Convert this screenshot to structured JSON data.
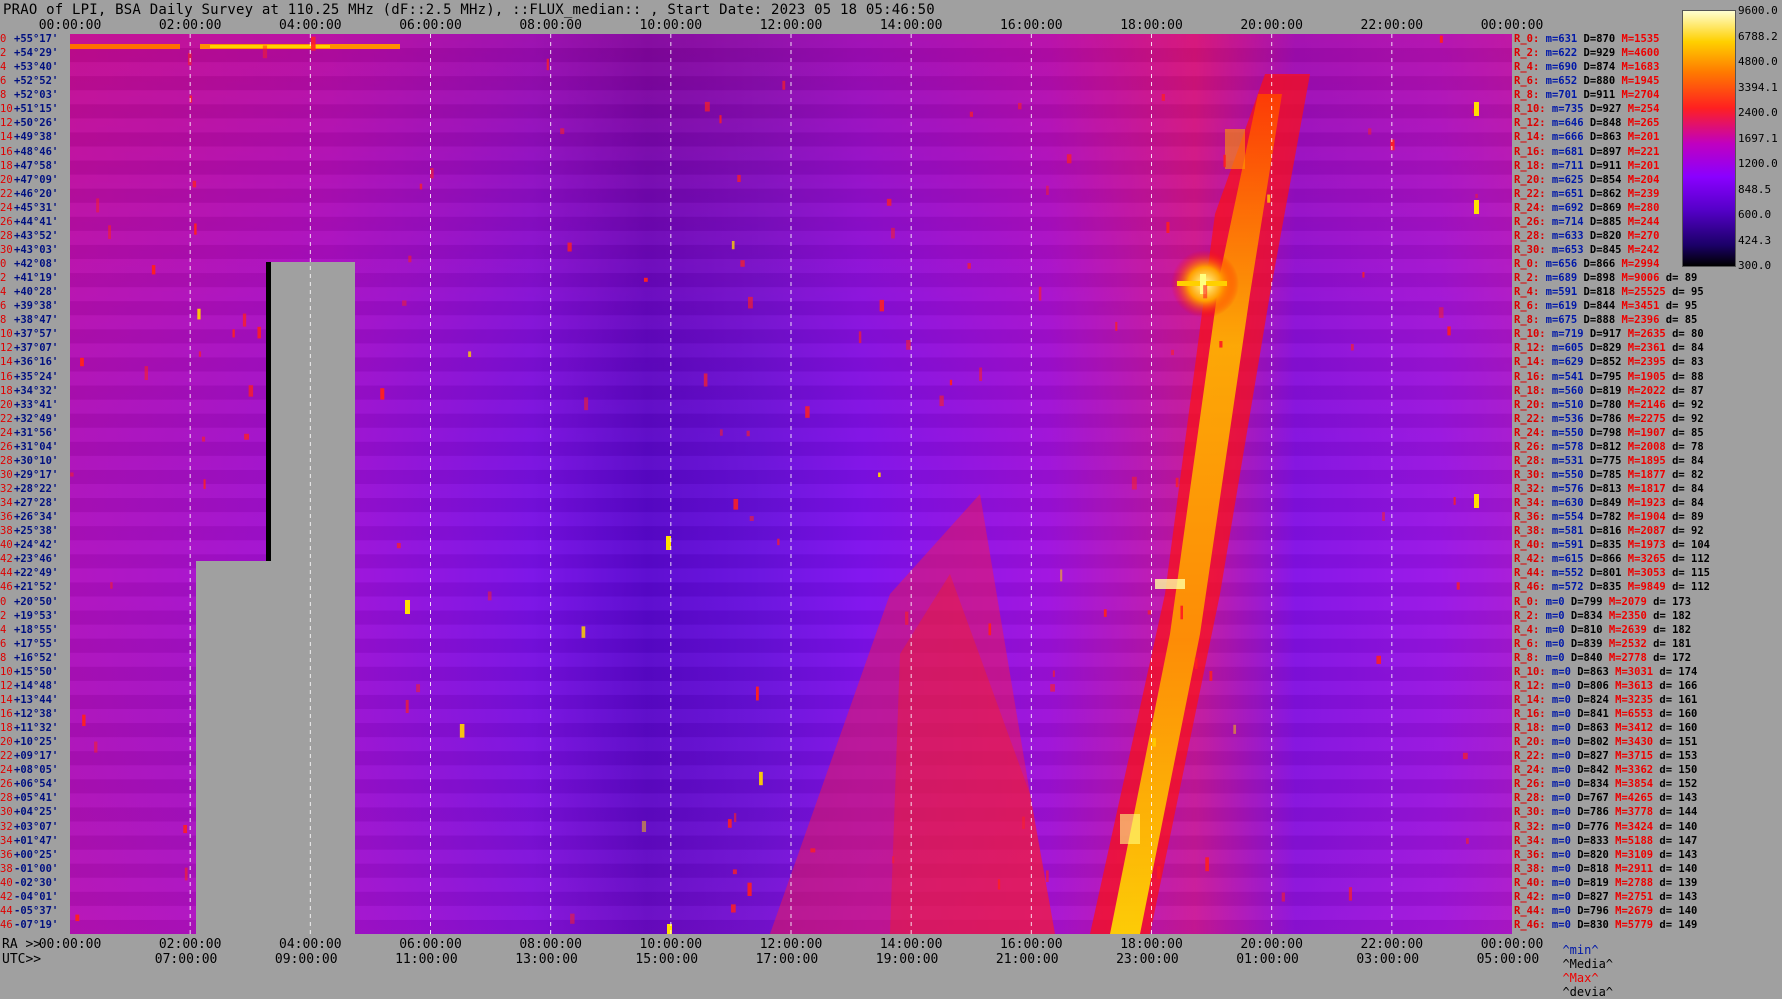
{
  "title": "PRAO of LPI, BSA Daily Survey at 110.25 MHz (dF::2.5 MHz), ::FLUX_median:: , Start Date: 2023 05 18 05:46:50",
  "top_axis": [
    "00:00:00",
    "02:00:00",
    "04:00:00",
    "06:00:00",
    "08:00:00",
    "10:00:00",
    "12:00:00",
    "14:00:00",
    "16:00:00",
    "18:00:00",
    "20:00:00",
    "22:00:00",
    "00:00:00"
  ],
  "bottom_axis_ra": {
    "prefix": "RA >>",
    "ticks": [
      "00:00:00",
      "02:00:00",
      "04:00:00",
      "06:00:00",
      "08:00:00",
      "10:00:00",
      "12:00:00",
      "14:00:00",
      "16:00:00",
      "18:00:00",
      "20:00:00",
      "22:00:00",
      "00:00:00"
    ]
  },
  "bottom_axis_utc": {
    "prefix": "UTC>>",
    "ticks": [
      "07:00:00",
      "09:00:00",
      "11:00:00",
      "13:00:00",
      "15:00:00",
      "17:00:00",
      "19:00:00",
      "21:00:00",
      "23:00:00",
      "01:00:00",
      "03:00:00",
      "05:00:00"
    ]
  },
  "dec_rows": [
    {
      "i": "0",
      "d": "+55°17'"
    },
    {
      "i": "2",
      "d": "+54°29'"
    },
    {
      "i": "4",
      "d": "+53°40'"
    },
    {
      "i": "6",
      "d": "+52°52'"
    },
    {
      "i": "8",
      "d": "+52°03'"
    },
    {
      "i": "10",
      "d": "+51°15'"
    },
    {
      "i": "12",
      "d": "+50°26'"
    },
    {
      "i": "14",
      "d": "+49°38'"
    },
    {
      "i": "16",
      "d": "+48°46'"
    },
    {
      "i": "18",
      "d": "+47°58'"
    },
    {
      "i": "20",
      "d": "+47°09'"
    },
    {
      "i": "22",
      "d": "+46°20'"
    },
    {
      "i": "24",
      "d": "+45°31'"
    },
    {
      "i": "26",
      "d": "+44°41'"
    },
    {
      "i": "28",
      "d": "+43°52'"
    },
    {
      "i": "30",
      "d": "+43°03'"
    },
    {
      "i": "0",
      "d": "+42°08'"
    },
    {
      "i": "2",
      "d": "+41°19'"
    },
    {
      "i": "4",
      "d": "+40°28'"
    },
    {
      "i": "6",
      "d": "+39°38'"
    },
    {
      "i": "8",
      "d": "+38°47'"
    },
    {
      "i": "10",
      "d": "+37°57'"
    },
    {
      "i": "12",
      "d": "+37°07'"
    },
    {
      "i": "14",
      "d": "+36°16'"
    },
    {
      "i": "16",
      "d": "+35°24'"
    },
    {
      "i": "18",
      "d": "+34°32'"
    },
    {
      "i": "20",
      "d": "+33°41'"
    },
    {
      "i": "22",
      "d": "+32°49'"
    },
    {
      "i": "24",
      "d": "+31°56'"
    },
    {
      "i": "26",
      "d": "+31°04'"
    },
    {
      "i": "28",
      "d": "+30°10'"
    },
    {
      "i": "30",
      "d": "+29°17'"
    },
    {
      "i": "32",
      "d": "+28°22'"
    },
    {
      "i": "34",
      "d": "+27°28'"
    },
    {
      "i": "36",
      "d": "+26°34'"
    },
    {
      "i": "38",
      "d": "+25°38'"
    },
    {
      "i": "40",
      "d": "+24°42'"
    },
    {
      "i": "42",
      "d": "+23°46'"
    },
    {
      "i": "44",
      "d": "+22°49'"
    },
    {
      "i": "46",
      "d": "+21°52'"
    },
    {
      "i": "0",
      "d": "+20°50'"
    },
    {
      "i": "2",
      "d": "+19°53'"
    },
    {
      "i": "4",
      "d": "+18°55'"
    },
    {
      "i": "6",
      "d": "+17°55'"
    },
    {
      "i": "8",
      "d": "+16°52'"
    },
    {
      "i": "10",
      "d": "+15°50'"
    },
    {
      "i": "12",
      "d": "+14°48'"
    },
    {
      "i": "14",
      "d": "+13°44'"
    },
    {
      "i": "16",
      "d": "+12°38'"
    },
    {
      "i": "18",
      "d": "+11°32'"
    },
    {
      "i": "20",
      "d": "+10°25'"
    },
    {
      "i": "22",
      "d": "+09°17'"
    },
    {
      "i": "24",
      "d": "+08°05'"
    },
    {
      "i": "26",
      "d": "+06°54'"
    },
    {
      "i": "28",
      "d": "+05°41'"
    },
    {
      "i": "30",
      "d": "+04°25'"
    },
    {
      "i": "32",
      "d": "+03°07'"
    },
    {
      "i": "34",
      "d": "+01°47'"
    },
    {
      "i": "36",
      "d": "+00°25'"
    },
    {
      "i": "38",
      "d": "-01°00'"
    },
    {
      "i": "40",
      "d": "-02°30'"
    },
    {
      "i": "42",
      "d": "-04°01'"
    },
    {
      "i": "44",
      "d": "-05°37'"
    },
    {
      "i": "46",
      "d": "-07°19'"
    }
  ],
  "colorbar": {
    "ticks": [
      "9600.0",
      "6788.2",
      "4800.0",
      "3394.1",
      "2400.0",
      "1697.1",
      "1200.0",
      "848.5",
      "600.0",
      "424.3",
      "300.0"
    ],
    "colors": [
      "#000000",
      "#1a0066",
      "#5500c8",
      "#8a00ff",
      "#c000c0",
      "#ff2020",
      "#ff7a00",
      "#ffd000",
      "#ffffd0"
    ]
  },
  "stats": [
    {
      "r": "R_0:",
      "m": "m=631",
      "D": "D=870",
      "M": "M=1535",
      "d": ""
    },
    {
      "r": "R_2:",
      "m": "m=622",
      "D": "D=929",
      "M": "M=4600",
      "d": ""
    },
    {
      "r": "R_4:",
      "m": "m=690",
      "D": "D=874",
      "M": "M=1683",
      "d": ""
    },
    {
      "r": "R_6:",
      "m": "m=652",
      "D": "D=880",
      "M": "M=1945",
      "d": ""
    },
    {
      "r": "R_8:",
      "m": "m=701",
      "D": "D=911",
      "M": "M=2704",
      "d": ""
    },
    {
      "r": "R_10:",
      "m": "m=735",
      "D": "D=927",
      "M": "M=254",
      "d": ""
    },
    {
      "r": "R_12:",
      "m": "m=646",
      "D": "D=848",
      "M": "M=265",
      "d": ""
    },
    {
      "r": "R_14:",
      "m": "m=666",
      "D": "D=863",
      "M": "M=201",
      "d": ""
    },
    {
      "r": "R_16:",
      "m": "m=681",
      "D": "D=897",
      "M": "M=221",
      "d": ""
    },
    {
      "r": "R_18:",
      "m": "m=711",
      "D": "D=911",
      "M": "M=201",
      "d": ""
    },
    {
      "r": "R_20:",
      "m": "m=625",
      "D": "D=854",
      "M": "M=204",
      "d": ""
    },
    {
      "r": "R_22:",
      "m": "m=651",
      "D": "D=862",
      "M": "M=239",
      "d": ""
    },
    {
      "r": "R_24:",
      "m": "m=692",
      "D": "D=869",
      "M": "M=280",
      "d": ""
    },
    {
      "r": "R_26:",
      "m": "m=714",
      "D": "D=885",
      "M": "M=244",
      "d": ""
    },
    {
      "r": "R_28:",
      "m": "m=633",
      "D": "D=820",
      "M": "M=270",
      "d": ""
    },
    {
      "r": "R_30:",
      "m": "m=653",
      "D": "D=845",
      "M": "M=242",
      "d": ""
    },
    {
      "r": "R_0:",
      "m": "m=656",
      "D": "D=866",
      "M": "M=2994",
      "d": ""
    },
    {
      "r": "R_2:",
      "m": "m=689",
      "D": "D=898",
      "M": "M=9006",
      "d": "d= 89"
    },
    {
      "r": "R_4:",
      "m": "m=591",
      "D": "D=818",
      "M": "M=25525",
      "d": "d= 95"
    },
    {
      "r": "R_6:",
      "m": "m=619",
      "D": "D=844",
      "M": "M=3451",
      "d": "d= 95"
    },
    {
      "r": "R_8:",
      "m": "m=675",
      "D": "D=888",
      "M": "M=2396",
      "d": "d= 85"
    },
    {
      "r": "R_10:",
      "m": "m=719",
      "D": "D=917",
      "M": "M=2635",
      "d": "d= 80"
    },
    {
      "r": "R_12:",
      "m": "m=605",
      "D": "D=829",
      "M": "M=2361",
      "d": "d= 84"
    },
    {
      "r": "R_14:",
      "m": "m=629",
      "D": "D=852",
      "M": "M=2395",
      "d": "d= 83"
    },
    {
      "r": "R_16:",
      "m": "m=541",
      "D": "D=795",
      "M": "M=1905",
      "d": "d= 88"
    },
    {
      "r": "R_18:",
      "m": "m=560",
      "D": "D=819",
      "M": "M=2022",
      "d": "d= 87"
    },
    {
      "r": "R_20:",
      "m": "m=510",
      "D": "D=780",
      "M": "M=2146",
      "d": "d= 92"
    },
    {
      "r": "R_22:",
      "m": "m=536",
      "D": "D=786",
      "M": "M=2275",
      "d": "d= 92"
    },
    {
      "r": "R_24:",
      "m": "m=550",
      "D": "D=798",
      "M": "M=1907",
      "d": "d= 85"
    },
    {
      "r": "R_26:",
      "m": "m=578",
      "D": "D=812",
      "M": "M=2008",
      "d": "d= 78"
    },
    {
      "r": "R_28:",
      "m": "m=531",
      "D": "D=775",
      "M": "M=1895",
      "d": "d= 84"
    },
    {
      "r": "R_30:",
      "m": "m=550",
      "D": "D=785",
      "M": "M=1877",
      "d": "d= 82"
    },
    {
      "r": "R_32:",
      "m": "m=576",
      "D": "D=813",
      "M": "M=1817",
      "d": "d= 84"
    },
    {
      "r": "R_34:",
      "m": "m=630",
      "D": "D=849",
      "M": "M=1923",
      "d": "d= 84"
    },
    {
      "r": "R_36:",
      "m": "m=554",
      "D": "D=782",
      "M": "M=1904",
      "d": "d= 89"
    },
    {
      "r": "R_38:",
      "m": "m=581",
      "D": "D=816",
      "M": "M=2087",
      "d": "d= 92"
    },
    {
      "r": "R_40:",
      "m": "m=591",
      "D": "D=835",
      "M": "M=1973",
      "d": "d= 104"
    },
    {
      "r": "R_42:",
      "m": "m=615",
      "D": "D=866",
      "M": "M=3265",
      "d": "d= 112"
    },
    {
      "r": "R_44:",
      "m": "m=552",
      "D": "D=801",
      "M": "M=3053",
      "d": "d= 115"
    },
    {
      "r": "R_46:",
      "m": "m=572",
      "D": "D=835",
      "M": "M=9849",
      "d": "d= 112"
    },
    {
      "r": "R_0:",
      "m": "m=0",
      "D": "D=799",
      "M": "M=2079",
      "d": "d= 173"
    },
    {
      "r": "R_2:",
      "m": "m=0",
      "D": "D=834",
      "M": "M=2350",
      "d": "d= 182"
    },
    {
      "r": "R_4:",
      "m": "m=0",
      "D": "D=810",
      "M": "M=2639",
      "d": "d= 182"
    },
    {
      "r": "R_6:",
      "m": "m=0",
      "D": "D=839",
      "M": "M=2532",
      "d": "d= 181"
    },
    {
      "r": "R_8:",
      "m": "m=0",
      "D": "D=840",
      "M": "M=2778",
      "d": "d= 172"
    },
    {
      "r": "R_10:",
      "m": "m=0",
      "D": "D=863",
      "M": "M=3031",
      "d": "d= 174"
    },
    {
      "r": "R_12:",
      "m": "m=0",
      "D": "D=806",
      "M": "M=3613",
      "d": "d= 166"
    },
    {
      "r": "R_14:",
      "m": "m=0",
      "D": "D=824",
      "M": "M=3235",
      "d": "d= 161"
    },
    {
      "r": "R_16:",
      "m": "m=0",
      "D": "D=841",
      "M": "M=6553",
      "d": "d= 160"
    },
    {
      "r": "R_18:",
      "m": "m=0",
      "D": "D=863",
      "M": "M=3412",
      "d": "d= 160"
    },
    {
      "r": "R_20:",
      "m": "m=0",
      "D": "D=802",
      "M": "M=3430",
      "d": "d= 151"
    },
    {
      "r": "R_22:",
      "m": "m=0",
      "D": "D=827",
      "M": "M=3715",
      "d": "d= 153"
    },
    {
      "r": "R_24:",
      "m": "m=0",
      "D": "D=842",
      "M": "M=3362",
      "d": "d= 150"
    },
    {
      "r": "R_26:",
      "m": "m=0",
      "D": "D=834",
      "M": "M=3854",
      "d": "d= 152"
    },
    {
      "r": "R_28:",
      "m": "m=0",
      "D": "D=767",
      "M": "M=4265",
      "d": "d= 143"
    },
    {
      "r": "R_30:",
      "m": "m=0",
      "D": "D=786",
      "M": "M=3778",
      "d": "d= 144"
    },
    {
      "r": "R_32:",
      "m": "m=0",
      "D": "D=776",
      "M": "M=3424",
      "d": "d= 140"
    },
    {
      "r": "R_34:",
      "m": "m=0",
      "D": "D=833",
      "M": "M=5188",
      "d": "d= 147"
    },
    {
      "r": "R_36:",
      "m": "m=0",
      "D": "D=820",
      "M": "M=3109",
      "d": "d= 143"
    },
    {
      "r": "R_38:",
      "m": "m=0",
      "D": "D=818",
      "M": "M=2911",
      "d": "d= 140"
    },
    {
      "r": "R_40:",
      "m": "m=0",
      "D": "D=819",
      "M": "M=2788",
      "d": "d= 139"
    },
    {
      "r": "R_42:",
      "m": "m=0",
      "D": "D=827",
      "M": "M=2751",
      "d": "d= 143"
    },
    {
      "r": "R_44:",
      "m": "m=0",
      "D": "D=796",
      "M": "M=2679",
      "d": "d= 140"
    },
    {
      "r": "R_46:",
      "m": "m=0",
      "D": "D=830",
      "M": "M=5779",
      "d": "d= 149"
    }
  ],
  "legend": {
    "min": "^min^",
    "median": "^Media^",
    "max": "^Max^",
    "devia": "^devia^"
  },
  "chart_data": {
    "type": "heatmap",
    "title": "PRAO of LPI, BSA Daily Survey at 110.25 MHz (dF::2.5 MHz), ::FLUX_median:: , Start Date: 2023 05 18 05:46:50",
    "x_axis": "RA 00:00:00 to 24:00:00 (UTC 05:46:50 start)",
    "y_axis": "Declination, 64 beams from +55°17' to -07°19'",
    "color_scale": "log",
    "vmin": 300.0,
    "vmax": 9600.0
  }
}
